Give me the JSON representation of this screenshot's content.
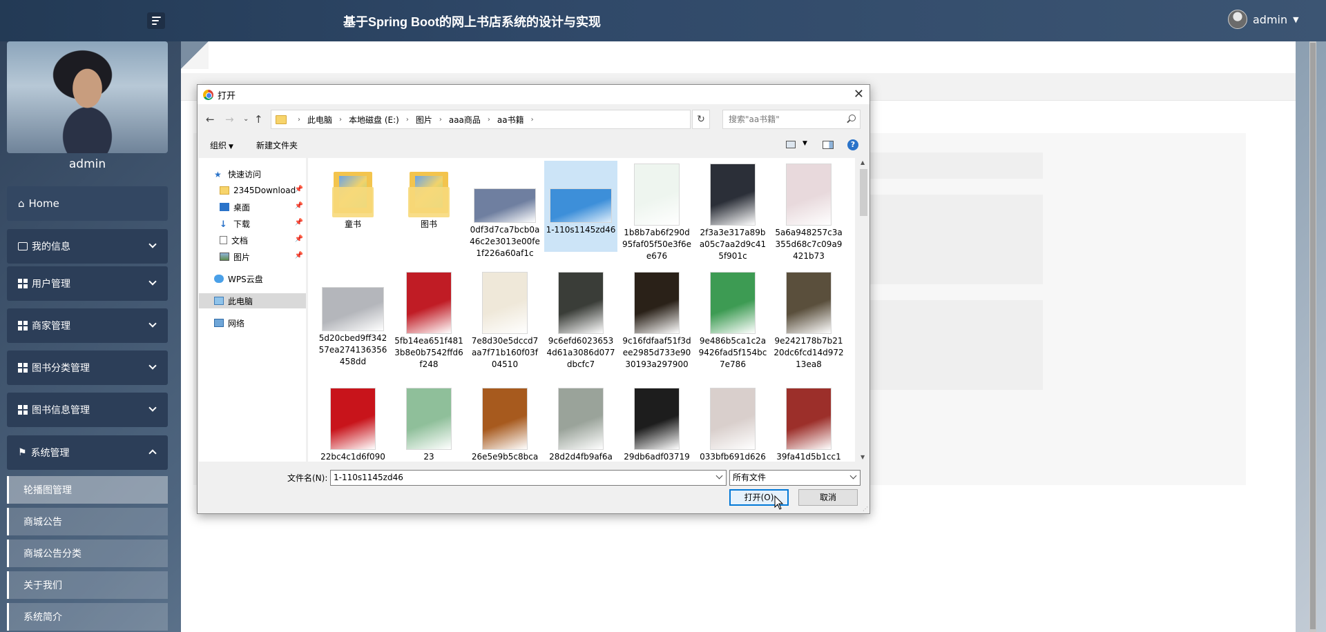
{
  "header": {
    "app_title": "基于Spring Boot的网上书店系统的设计与实现",
    "user_name": "admin"
  },
  "sidebar": {
    "profile_name": "admin",
    "items": [
      {
        "label": "Home",
        "icon": "home-icon"
      },
      {
        "label": "我的信息",
        "icon": "id-card-icon"
      },
      {
        "label": "用户管理",
        "icon": "grid-icon"
      },
      {
        "label": "商家管理",
        "icon": "grid-icon"
      },
      {
        "label": "图书分类管理",
        "icon": "grid-icon"
      },
      {
        "label": "图书信息管理",
        "icon": "grid-icon"
      },
      {
        "label": "系统管理",
        "icon": "flag-icon"
      }
    ],
    "subitems": [
      "轮播图管理",
      "商城公告",
      "商城公告分类",
      "关于我们",
      "系统简介"
    ]
  },
  "dialog": {
    "title": "打开",
    "breadcrumb": [
      "此电脑",
      "本地磁盘 (E:)",
      "图片",
      "aaa商品",
      "aa书籍"
    ],
    "search_placeholder": "搜索\"aa书籍\"",
    "toolbar": {
      "organize": "组织",
      "new_folder": "新建文件夹"
    },
    "nav_pane": {
      "quick_access": "快速访问",
      "items": [
        "2345Download",
        "桌面",
        "下载",
        "文档",
        "图片"
      ],
      "wps": "WPS云盘",
      "this_pc": "此电脑",
      "network": "网络"
    },
    "files": [
      {
        "name": "童书",
        "kind": "folder"
      },
      {
        "name": "图书",
        "kind": "folder"
      },
      {
        "name": "0df3d7ca7bcb0a46c2e3013e00fe1f226a60af1c",
        "kind": "image",
        "color": "#6f7fa0"
      },
      {
        "name": "1-110s1145zd46",
        "kind": "image",
        "color": "#3d8fd9"
      },
      {
        "name": "1b8b7ab6f290d95faf05f50e3f6ee676",
        "kind": "image",
        "color": "#eef5ef"
      },
      {
        "name": "2f3a3e317a89ba05c7aa2d9c415f901c",
        "kind": "image",
        "color": "#2b2f38"
      },
      {
        "name": "5a6a948257c3a355d68c7c09a9421b73",
        "kind": "image",
        "color": "#e8d9dc"
      },
      {
        "name": "5d20cbed9ff34257ea274136356458dd",
        "kind": "image",
        "color": "#b4b6bb"
      },
      {
        "name": "5fb14ea651f4813b8e0b7542ffd6f248",
        "kind": "image",
        "color": "#c01c25"
      },
      {
        "name": "7e8d30e5dccd7aa7f71b160f03f04510",
        "kind": "image",
        "color": "#efe8d9"
      },
      {
        "name": "9c6efd60236534d61a3086d077dbcfc7",
        "kind": "image",
        "color": "#3a3d38"
      },
      {
        "name": "9c16fdfaaf51f3dee2985d733e9030193a297900",
        "kind": "image",
        "color": "#2a2118"
      },
      {
        "name": "9e486b5ca1c2a9426fad5f154bc7e786",
        "kind": "image",
        "color": "#3d9b53"
      },
      {
        "name": "9e242178b7b2120dc6fcd14d97213ea8",
        "kind": "image",
        "color": "#5a4f3c"
      },
      {
        "name": "22bc4c1d6f090",
        "kind": "image",
        "color": "#c8141b"
      },
      {
        "name": "23",
        "kind": "image",
        "color": "#8fbf9a"
      },
      {
        "name": "26e5e9b5c8bca",
        "kind": "image",
        "color": "#a75a1e"
      },
      {
        "name": "28d2d4fb9af6a",
        "kind": "image",
        "color": "#9aa39a"
      },
      {
        "name": "29db6adf03719",
        "kind": "image",
        "color": "#1d1d1d"
      },
      {
        "name": "033bfb691d626",
        "kind": "image",
        "color": "#d9cfcc"
      },
      {
        "name": "39fa41d5b1cc1",
        "kind": "image",
        "color": "#9c2f2a"
      }
    ],
    "filename_label": "文件名(N):",
    "filename_value": "1-110s1145zd46",
    "filetype_value": "所有文件",
    "open_button": "打开(O)",
    "cancel_button": "取消"
  }
}
